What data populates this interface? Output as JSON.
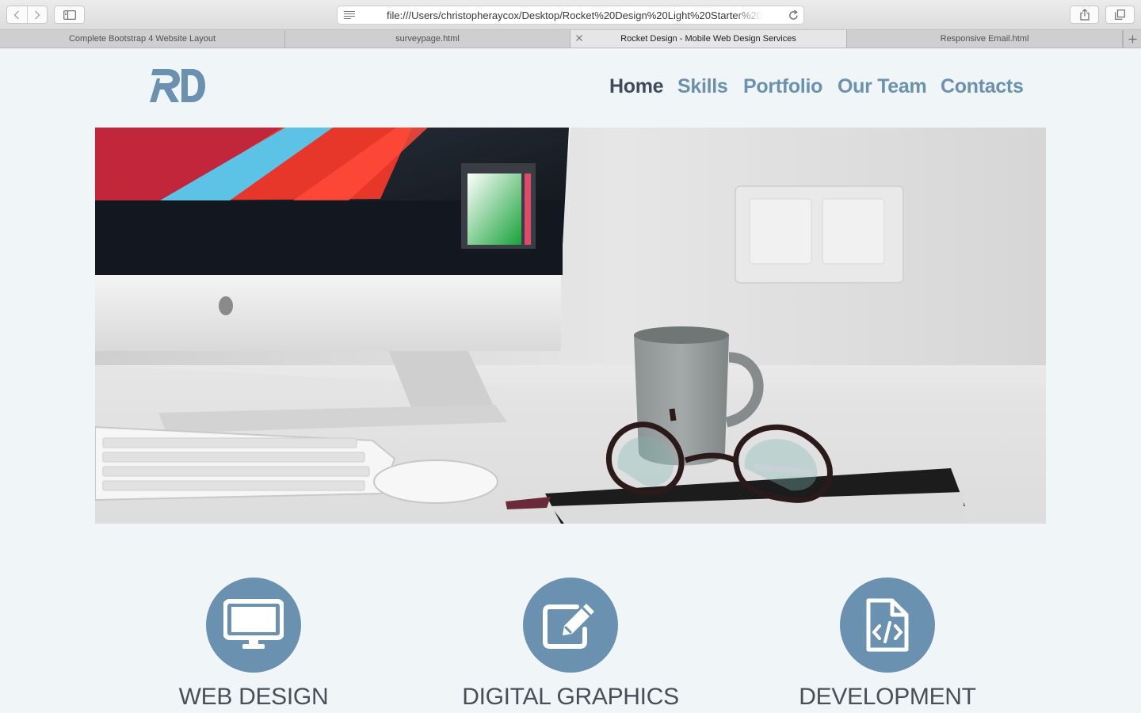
{
  "browser": {
    "url": "file:///Users/christopheraycox/Desktop/Rocket%20Design%20Light%20Starter%20",
    "tabs": [
      {
        "label": "Complete Bootstrap 4 Website Layout"
      },
      {
        "label": "surveypage.html"
      },
      {
        "label": "Rocket Design - Mobile Web Design Services"
      },
      {
        "label": "Responsive Email.html"
      }
    ],
    "icons": {
      "back": "chevron-left-icon",
      "forward": "chevron-right-icon",
      "sidebar": "sidebar-icon",
      "reader": "reader-icon",
      "reload": "reload-icon",
      "share": "share-icon",
      "tabs": "tabs-overview-icon",
      "new_tab": "plus-icon",
      "close_tab": "close-icon"
    }
  },
  "site": {
    "logo_text": "RD",
    "nav": [
      {
        "label": "Home"
      },
      {
        "label": "Skills"
      },
      {
        "label": "Portfolio"
      },
      {
        "label": "Our Team"
      },
      {
        "label": "Contacts"
      }
    ],
    "hero_image": "desk-workspace-photo",
    "services": [
      {
        "title": "WEB DESIGN",
        "icon": "desktop-monitor-icon"
      },
      {
        "title": "DIGITAL GRAPHICS",
        "icon": "edit-pencil-icon"
      },
      {
        "title": "DEVELOPMENT",
        "icon": "code-file-icon"
      }
    ],
    "colors": {
      "accent": "#6a91b0",
      "nav_active": "#3f4b58",
      "background": "#f0f5f8",
      "heading": "#4a4f56"
    }
  }
}
